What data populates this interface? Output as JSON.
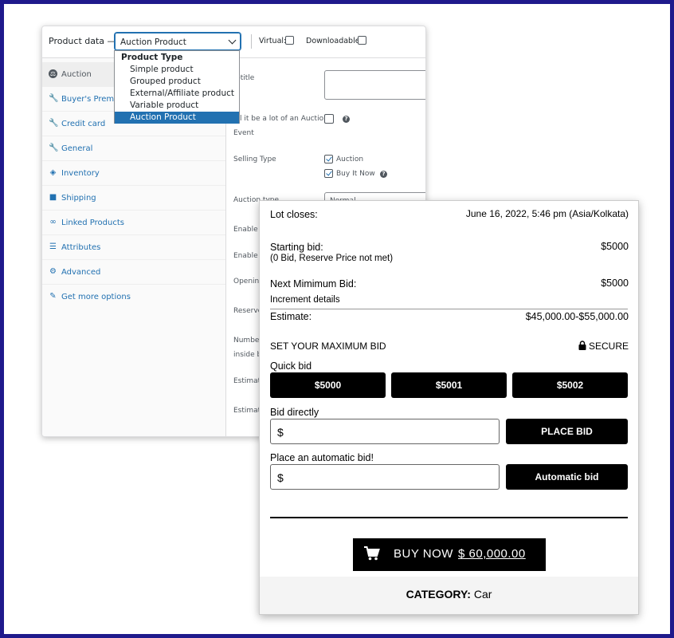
{
  "product_data": {
    "title": "Product data —",
    "select_value": "Auction Product",
    "virtual_label": "Virtual:",
    "downloadable_label": "Downloadable:",
    "dropdown": {
      "group": "Product Type",
      "options": [
        "Simple product",
        "Grouped product",
        "External/Affiliate product",
        "Variable product",
        "Auction Product"
      ],
      "selected": "Auction Product"
    },
    "tabs": [
      {
        "label": "Auction",
        "icon": "auction-icon"
      },
      {
        "label": "Buyer's Premium",
        "icon": "wrench-icon"
      },
      {
        "label": "Credit card",
        "icon": "wrench-icon"
      },
      {
        "label": "General",
        "icon": "wrench-icon"
      },
      {
        "label": "Inventory",
        "icon": "tag-icon"
      },
      {
        "label": "Shipping",
        "icon": "truck-icon"
      },
      {
        "label": "Linked Products",
        "icon": "link-icon"
      },
      {
        "label": "Attributes",
        "icon": "list-icon"
      },
      {
        "label": "Advanced",
        "icon": "gear-icon"
      },
      {
        "label": "Get more options",
        "icon": "plug-icon"
      }
    ],
    "fields": {
      "subtitle": "btitle",
      "lot_line1": "ill it be a lot of an Auction",
      "lot_line2": "Event",
      "selling_type": "Selling Type",
      "auction": "Auction",
      "buy_it_now": "Buy It Now",
      "auction_type": "Auction type",
      "auction_type_value": "Normal",
      "enable_p": "Enable P",
      "enable_s": "Enable S",
      "opening": "Opening",
      "reserve": "Reserve",
      "number": "Number",
      "inside_bi": "inside bi",
      "estimate1": "Estimate",
      "estimate2": "Estimate"
    }
  },
  "auction": {
    "lot_closes_label": "Lot closes:",
    "lot_closes_value": "June 16, 2022, 5:46 pm (Asia/Kolkata)",
    "starting_bid_label": "Starting bid:",
    "starting_bid_value": "$5000",
    "starting_bid_note": "(0 Bid, Reserve Price not met)",
    "next_min_label": "Next Mimimum Bid:",
    "next_min_value": "$5000",
    "increment_details": "Increment details",
    "estimate_label": "Estimate:",
    "estimate_value": "$45,000.00-$55,000.00",
    "set_max_bid": "SET YOUR MAXIMUM BID",
    "secure": "SECURE",
    "quick_bid_label": "Quick bid",
    "quick_bids": [
      "$5000",
      "$5001",
      "$5002"
    ],
    "bid_directly_label": "Bid directly",
    "currency": "$",
    "place_bid": "PLACE BID",
    "auto_bid_label": "Place an automatic bid!",
    "auto_bid_button": "Automatic bid",
    "buy_now_label": "BUY NOW",
    "buy_now_price": "$ 60,000.00",
    "category_label": "CATEGORY:",
    "category_value": "Car"
  },
  "colors": {
    "frame": "#1f1a8c",
    "wp_link": "#2271b1",
    "button": "#000000"
  }
}
